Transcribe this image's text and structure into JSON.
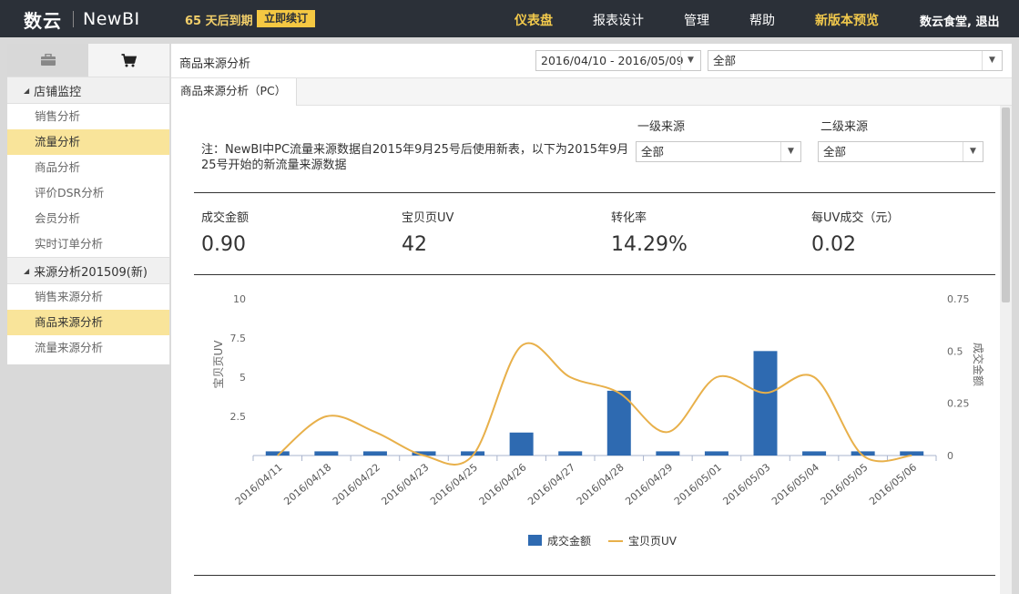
{
  "topbar": {
    "logo_cn": "数云",
    "logo_en": "NewBI",
    "expire_text": "65 天后到期",
    "renew_label": "立即续订",
    "nav": [
      "仪表盘",
      "报表设计",
      "管理",
      "帮助",
      "新版本预览"
    ],
    "user": "数云食堂, 退出"
  },
  "sidebar": {
    "tabs": [
      "briefcase-icon",
      "cart-icon"
    ],
    "groups": [
      {
        "label": "店铺监控",
        "items": [
          "销售分析",
          "流量分析",
          "商品分析",
          "评价DSR分析",
          "会员分析",
          "实时订单分析"
        ],
        "selected": 1
      },
      {
        "label": "来源分析201509(新)",
        "items": [
          "销售来源分析",
          "商品来源分析",
          "流量来源分析"
        ],
        "selected": 1
      }
    ]
  },
  "main": {
    "title": "商品来源分析",
    "date_range": "2016/04/10 - 2016/05/09",
    "scope": "全部",
    "tab": "商品来源分析（PC）",
    "note": "注：NewBI中PC流量来源数据自2015年9月25号后使用新表，以下为2015年9月25号开始的新流量来源数据",
    "filters": [
      {
        "label": "一级来源",
        "value": "全部"
      },
      {
        "label": "二级来源",
        "value": "全部"
      }
    ],
    "kpis": [
      {
        "label": "成交金额",
        "value": "0.90"
      },
      {
        "label": "宝贝页UV",
        "value": "42"
      },
      {
        "label": "转化率",
        "value": "14.29%"
      },
      {
        "label": "每UV成交（元）",
        "value": "0.02"
      }
    ]
  },
  "chart_data": {
    "type": "bar",
    "categories": [
      "2016/04/11",
      "2016/04/18",
      "2016/04/22",
      "2016/04/23",
      "2016/04/25",
      "2016/04/26",
      "2016/04/27",
      "2016/04/28",
      "2016/04/29",
      "2016/05/01",
      "2016/05/03",
      "2016/05/04",
      "2016/05/05",
      "2016/05/06"
    ],
    "series": [
      {
        "name": "成交金额",
        "type": "bar",
        "axis": "right",
        "color": "#2e6ab1",
        "values": [
          0.02,
          0.02,
          0.02,
          0.02,
          0.02,
          0.11,
          0.02,
          0.31,
          0.02,
          0.02,
          0.5,
          0.02,
          0.02,
          0.02
        ]
      },
      {
        "name": "宝贝页UV",
        "type": "line",
        "axis": "left",
        "color": "#e8b04a",
        "values": [
          0,
          2.5,
          1.5,
          0,
          0,
          7,
          5,
          4,
          1.5,
          5,
          4,
          5,
          0,
          0
        ]
      }
    ],
    "left_axis": {
      "label": "宝贝页UV",
      "ticks": [
        "2.5",
        "5",
        "7.5",
        "10"
      ],
      "range": [
        0,
        10
      ]
    },
    "right_axis": {
      "label": "成交金额",
      "ticks": [
        "0",
        "0.25",
        "0.5",
        "0.75"
      ],
      "range": [
        0,
        0.75
      ]
    },
    "legend": "bottom-center"
  }
}
